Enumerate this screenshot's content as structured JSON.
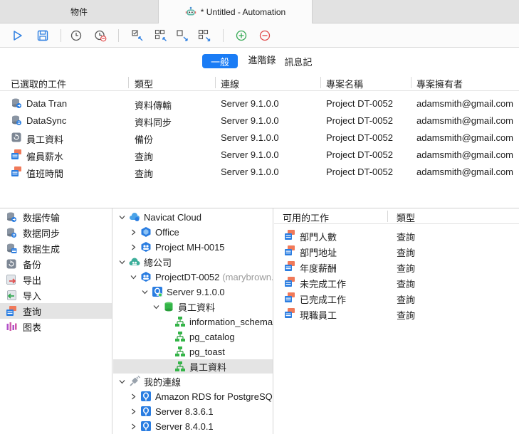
{
  "tabs": {
    "objects": "物件",
    "active": "* Untitled - Automation"
  },
  "toolbar": {
    "run": "play-icon",
    "save": "save-icon",
    "schedule": "clock-icon",
    "remove_schedule": "clock-remove-icon"
  },
  "subtabs": {
    "general": "一般",
    "advanced": "進階錄",
    "log": "訊息記"
  },
  "selected_grid": {
    "headers": [
      "已選取的工件",
      "類型",
      "連線",
      "專案名稱",
      "專案擁有者"
    ],
    "rows": [
      {
        "name": "Data Tran",
        "type": "資料傳輸",
        "conn": "Server 9.1.0.0",
        "project": "Project DT-0052",
        "owner": "adamsmith@gmail.com",
        "icon": "data-transfer"
      },
      {
        "name": "DataSync",
        "type": "資料同步",
        "conn": "Server 9.1.0.0",
        "project": "Project DT-0052",
        "owner": "adamsmith@gmail.com",
        "icon": "data-sync"
      },
      {
        "name": "員工資料",
        "type": "備份",
        "conn": "Server 9.1.0.0",
        "project": "Project DT-0052",
        "owner": "adamsmith@gmail.com",
        "icon": "backup"
      },
      {
        "name": "僱員薪水",
        "type": "查詢",
        "conn": "Server 9.1.0.0",
        "project": "Project DT-0052",
        "owner": "adamsmith@gmail.com",
        "icon": "query"
      },
      {
        "name": "值班時間",
        "type": "查詢",
        "conn": "Server 9.1.0.0",
        "project": "Project DT-0052",
        "owner": "adamsmith@gmail.com",
        "icon": "query"
      }
    ]
  },
  "categories": [
    {
      "label": "数据传输",
      "icon": "data-transfer"
    },
    {
      "label": "数据同步",
      "icon": "data-sync"
    },
    {
      "label": "数据生成",
      "icon": "data-generation"
    },
    {
      "label": "备份",
      "icon": "backup"
    },
    {
      "label": "导出",
      "icon": "export"
    },
    {
      "label": "导入",
      "icon": "import"
    },
    {
      "label": "查询",
      "icon": "query"
    },
    {
      "label": "图表",
      "icon": "chart"
    }
  ],
  "tree": {
    "cloud": "Navicat Cloud",
    "office": "Office",
    "project_mh": "Project MH-0015",
    "company": "總公司",
    "project_dt": "ProjectDT-0052",
    "project_dt_owner": "(marybrown...",
    "server": "Server 9.1.0.0",
    "db": "員工資料",
    "schemas": [
      "information_schema",
      "pg_catalog",
      "pg_toast",
      "員工資料"
    ],
    "my_conn": "我的連線",
    "connections": [
      "Amazon RDS for PostgreSQL",
      "Server 8.3.6.1",
      "Server 8.4.0.1"
    ]
  },
  "available": {
    "headers": [
      "可用的工作",
      "類型"
    ],
    "rows": [
      {
        "name": "部門人數",
        "type": "查詢"
      },
      {
        "name": "部門地址",
        "type": "查詢"
      },
      {
        "name": "年度薪酬",
        "type": "查詢"
      },
      {
        "name": "未完成工作",
        "type": "查詢"
      },
      {
        "name": "已完成工作",
        "type": "查詢"
      },
      {
        "name": "現職員工",
        "type": "查詢"
      }
    ]
  }
}
